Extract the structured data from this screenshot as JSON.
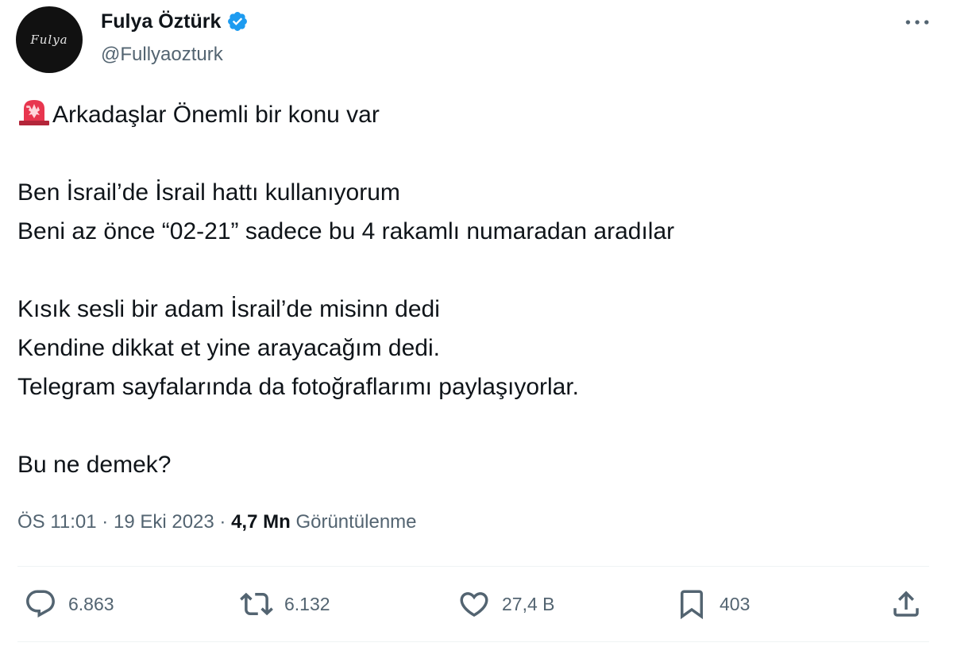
{
  "author": {
    "display_name": "Fulya Öztürk",
    "handle": "@Fullyaozturk",
    "avatar_logo_text": "Fulya",
    "verified_icon": "verified-badge-icon",
    "verified_color": "#1d9bf0"
  },
  "more_icon": "more-horizontal-icon",
  "tweet": {
    "lines": [
      "Arkadaşlar Önemli bir konu var",
      "",
      "Ben İsrail’de İsrail hattı kullanıyorum",
      "Beni az önce “02-21” sadece bu 4 rakamlı numaradan aradılar",
      "",
      "Kısık sesli bir adam İsrail’de misinn dedi",
      "Kendine dikkat et yine arayacağım dedi.",
      "Telegram sayfalarında da fotoğraflarımı paylaşıyorlar.",
      "",
      "Bu ne demek?"
    ],
    "leading_emoji": "police-car-light-icon"
  },
  "meta": {
    "time": "ÖS 11:01",
    "separator": "·",
    "date": "19 Eki 2023",
    "views_count": "4,7 Mn",
    "views_label": "Görüntülenme"
  },
  "actions": {
    "reply": {
      "icon": "reply-icon",
      "count": "6.863"
    },
    "retweet": {
      "icon": "retweet-icon",
      "count": "6.132"
    },
    "like": {
      "icon": "heart-icon",
      "count": "27,4 B"
    },
    "bookmark": {
      "icon": "bookmark-icon",
      "count": "403"
    },
    "share": {
      "icon": "share-icon"
    }
  },
  "colors": {
    "text_primary": "#0f1419",
    "text_secondary": "#536471",
    "divider": "#eff3f4"
  }
}
